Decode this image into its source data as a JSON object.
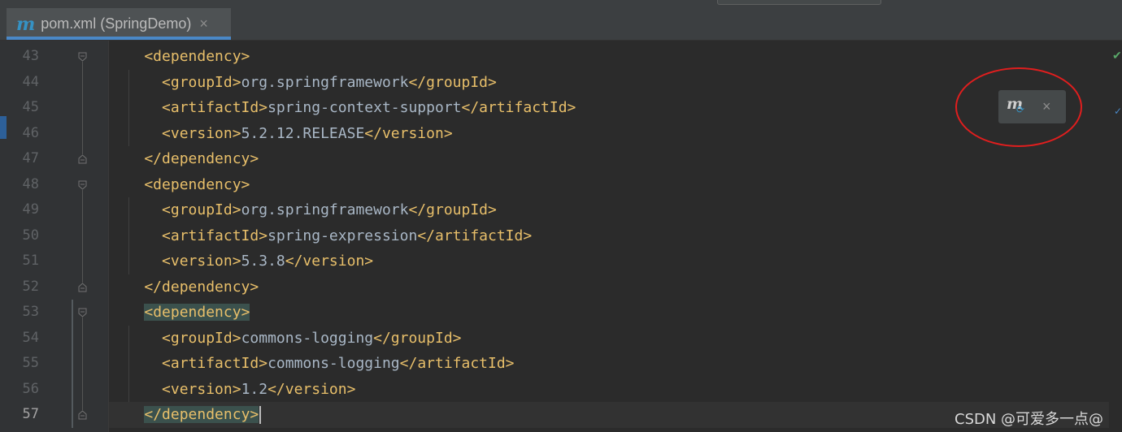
{
  "tab": {
    "title": "pom.xml (SpringDemo)",
    "icon": "maven-icon",
    "close": "×"
  },
  "gutter": {
    "line_numbers": [
      "43",
      "44",
      "45",
      "46",
      "47",
      "48",
      "49",
      "50",
      "51",
      "52",
      "53",
      "54",
      "55",
      "56",
      "57"
    ],
    "current_line": "57"
  },
  "editor": {
    "lines": [
      [
        {
          "t": "tag",
          "v": "    <dependency>"
        }
      ],
      [
        {
          "t": "tag",
          "v": "      <groupId>"
        },
        {
          "t": "txt",
          "v": "org.springframework"
        },
        {
          "t": "tag",
          "v": "</groupId>"
        }
      ],
      [
        {
          "t": "tag",
          "v": "      <artifactId>"
        },
        {
          "t": "txt",
          "v": "spring-context-support"
        },
        {
          "t": "tag",
          "v": "</artifactId>"
        }
      ],
      [
        {
          "t": "tag",
          "v": "      <version>"
        },
        {
          "t": "txt",
          "v": "5.2.12.RELEASE"
        },
        {
          "t": "tag",
          "v": "</version>"
        }
      ],
      [
        {
          "t": "tag",
          "v": "    </dependency>"
        }
      ],
      [
        {
          "t": "tag",
          "v": "    <dependency>"
        }
      ],
      [
        {
          "t": "tag",
          "v": "      <groupId>"
        },
        {
          "t": "txt",
          "v": "org.springframework"
        },
        {
          "t": "tag",
          "v": "</groupId>"
        }
      ],
      [
        {
          "t": "tag",
          "v": "      <artifactId>"
        },
        {
          "t": "txt",
          "v": "spring-expression"
        },
        {
          "t": "tag",
          "v": "</artifactId>"
        }
      ],
      [
        {
          "t": "tag",
          "v": "      <version>"
        },
        {
          "t": "txt",
          "v": "5.3.8"
        },
        {
          "t": "tag",
          "v": "</version>"
        }
      ],
      [
        {
          "t": "tag",
          "v": "    </dependency>"
        }
      ],
      [
        {
          "t": "pad",
          "v": "    "
        },
        {
          "t": "tag hl",
          "v": "<dependency>"
        }
      ],
      [
        {
          "t": "tag",
          "v": "      <groupId>"
        },
        {
          "t": "txt",
          "v": "commons-logging"
        },
        {
          "t": "tag",
          "v": "</groupId>"
        }
      ],
      [
        {
          "t": "tag",
          "v": "      <artifactId>"
        },
        {
          "t": "txt",
          "v": "commons-logging"
        },
        {
          "t": "tag",
          "v": "</artifactId>"
        }
      ],
      [
        {
          "t": "tag",
          "v": "      <version>"
        },
        {
          "t": "txt",
          "v": "1.2"
        },
        {
          "t": "tag",
          "v": "</version>"
        }
      ],
      [
        {
          "t": "pad",
          "v": "    "
        },
        {
          "t": "tag hl",
          "v": "</dependency>"
        },
        {
          "t": "caret",
          "v": ""
        }
      ]
    ]
  },
  "popup": {
    "icon": "maven-reload-icon",
    "close": "×"
  },
  "watermark": "CSDN @可爱多一点@",
  "colors": {
    "background": "#2b2b2b",
    "tag": "#e8bf6a",
    "text": "#a9b7c6",
    "annotation": "#e01e1e"
  }
}
